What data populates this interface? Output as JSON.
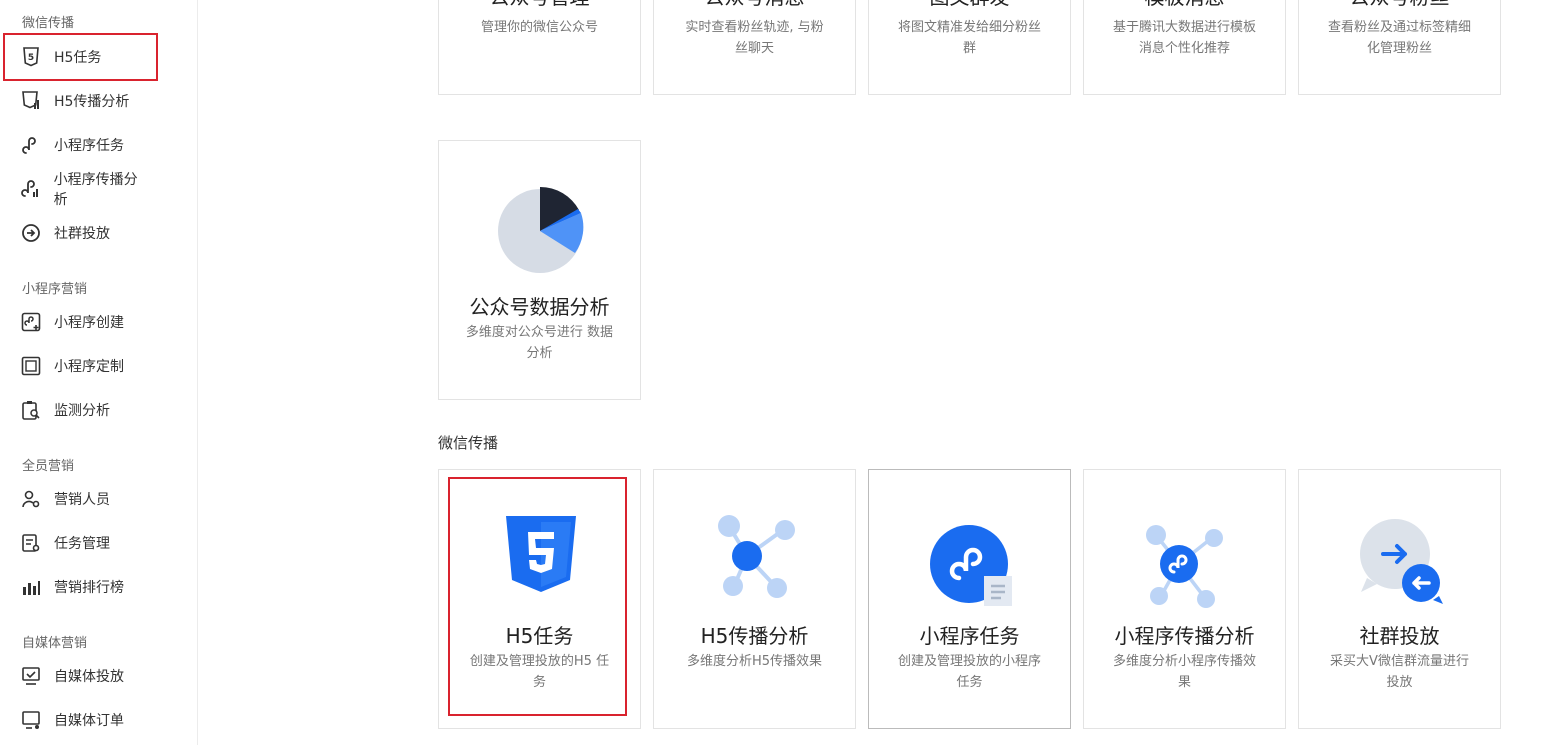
{
  "sidebar": {
    "sections": [
      {
        "title": "微信传播",
        "items": [
          {
            "label": "H5任务",
            "icon": "html5-icon",
            "active": true
          },
          {
            "label": "H5传播分析",
            "icon": "html5-analysis-icon"
          },
          {
            "label": "小程序任务",
            "icon": "miniprogram-icon"
          },
          {
            "label": "小程序传播分析",
            "icon": "miniprogram-analysis-icon"
          },
          {
            "label": "社群投放",
            "icon": "share-arrow-icon"
          }
        ]
      },
      {
        "title": "小程序营销",
        "items": [
          {
            "label": "小程序创建",
            "icon": "miniprogram-create-icon"
          },
          {
            "label": "小程序定制",
            "icon": "frame-icon"
          },
          {
            "label": "监测分析",
            "icon": "clipboard-search-icon"
          }
        ]
      },
      {
        "title": "全员营销",
        "items": [
          {
            "label": "营销人员",
            "icon": "user-gear-icon"
          },
          {
            "label": "任务管理",
            "icon": "task-gear-icon"
          },
          {
            "label": "营销排行榜",
            "icon": "bar-chart-icon"
          }
        ]
      },
      {
        "title": "自媒体营销",
        "items": [
          {
            "label": "自媒体投放",
            "icon": "monitor-check-icon"
          },
          {
            "label": "自媒体订单",
            "icon": "monitor-cart-icon"
          }
        ]
      }
    ]
  },
  "top_cards": [
    {
      "title": "公众号管理",
      "desc": "管理你的微信公众号"
    },
    {
      "title": "公众号消息",
      "desc": "实时查看粉丝轨迹, 与粉丝聊天"
    },
    {
      "title": "图文群发",
      "desc": "将图文精准发给细分粉丝群"
    },
    {
      "title": "模板消息",
      "desc": "基于腾讯大数据进行模板消息个性化推荐"
    },
    {
      "title": "公众号粉丝",
      "desc": "查看粉丝及通过标签精细化管理粉丝"
    }
  ],
  "analytics_card": {
    "title": "公众号数据分析",
    "desc": "多维度对公众号进行 数据分析",
    "icon": "pie-chart-icon"
  },
  "wechat_section": {
    "label": "微信传播",
    "cards": [
      {
        "title": "H5任务",
        "desc": "创建及管理投放的H5 任务",
        "icon": "html5-icon",
        "highlighted": true
      },
      {
        "title": "H5传播分析",
        "desc": "多维度分析H5传播效果",
        "icon": "network-nodes-icon"
      },
      {
        "title": "小程序任务",
        "desc": "创建及管理投放的小程序任务",
        "icon": "miniprogram-doc-icon"
      },
      {
        "title": "小程序传播分析",
        "desc": "多维度分析小程序传播效果",
        "icon": "miniprogram-network-icon"
      },
      {
        "title": "社群投放",
        "desc": "采买大V微信群流量进行投放",
        "icon": "chat-arrows-icon"
      }
    ]
  },
  "colors": {
    "accent": "#1a6cf0",
    "highlight": "#d9232e",
    "light_blue": "#bcd4f6",
    "dark": "#1f2533"
  }
}
